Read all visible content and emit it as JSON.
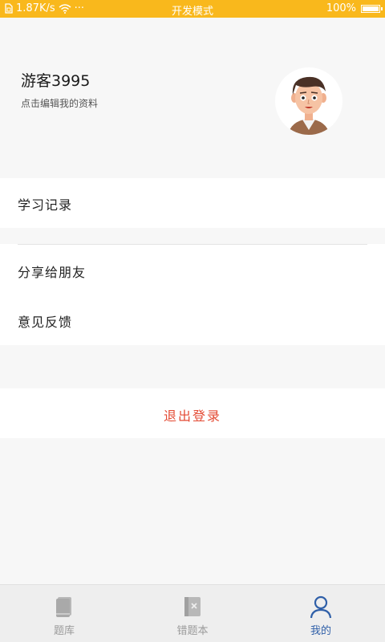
{
  "status_bar": {
    "speed": "1.87K/s",
    "dots": "···",
    "mode": "开发模式",
    "battery": "100%"
  },
  "profile": {
    "username": "游客3995",
    "edit_hint": "点击编辑我的资料"
  },
  "menu": {
    "study_record": "学习记录",
    "share": "分享给朋友",
    "feedback": "意见反馈",
    "logout": "退出登录"
  },
  "tabs": [
    {
      "label": "题库",
      "icon": "book-icon",
      "active": false
    },
    {
      "label": "错题本",
      "icon": "wrong-book-icon",
      "active": false
    },
    {
      "label": "我的",
      "icon": "person-icon",
      "active": true
    }
  ],
  "colors": {
    "status_bar": "#f9b81c",
    "logout_text": "#e34a33",
    "active_tab": "#2f5fa8",
    "inactive_tab": "#9b9b9b"
  }
}
